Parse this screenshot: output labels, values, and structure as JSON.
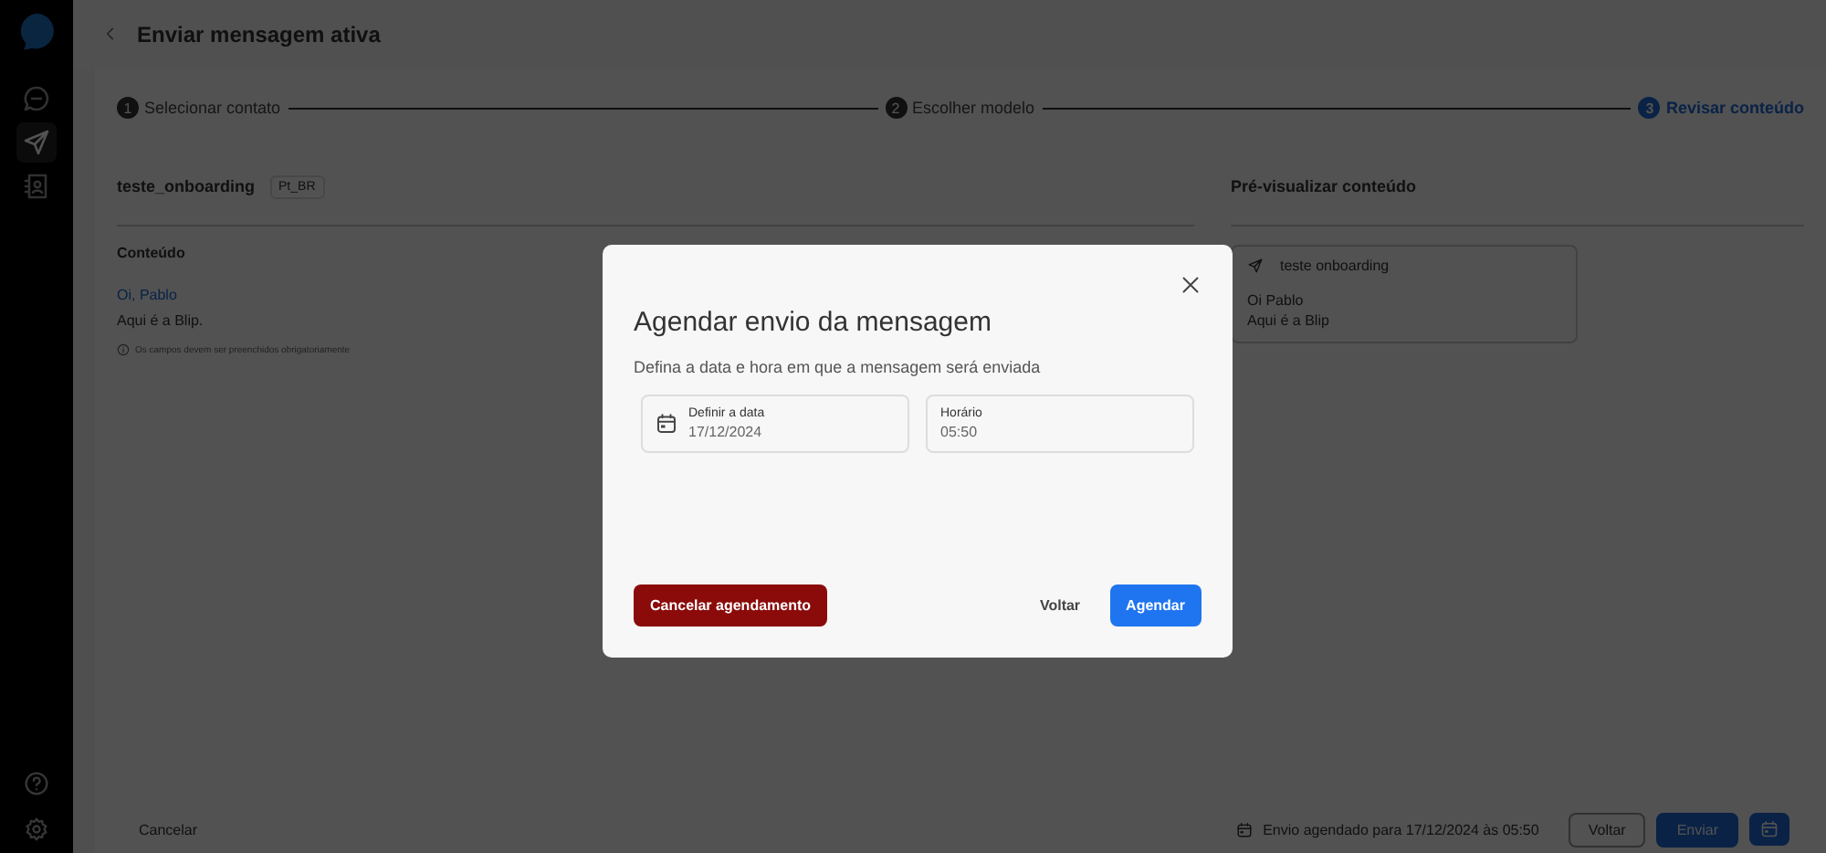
{
  "sidebar": {
    "items": [
      {
        "selected": false
      },
      {
        "selected": true
      },
      {
        "selected": false
      }
    ]
  },
  "header": {
    "title": "Enviar mensagem ativa"
  },
  "steps": [
    {
      "number": "1",
      "label": "Selecionar contato",
      "selected": false
    },
    {
      "number": "2",
      "label": "Escolher modelo",
      "selected": false
    },
    {
      "number": "3",
      "label": "Revisar conteúdo",
      "selected": true
    }
  ],
  "template": {
    "name": "teste_onboarding",
    "language": "Pt_BR"
  },
  "content": {
    "heading": "Conteúdo",
    "greeting": "Oi, Pablo",
    "body": "Aqui é a Blip.",
    "note": "Os campos devem ser preenchidos obrigatoriamente"
  },
  "preview": {
    "heading": "Pré-visualizar conteúdo",
    "title": "teste onboarding",
    "lines": [
      "Oi Pablo",
      "Aqui é a Blip"
    ]
  },
  "footer": {
    "cancel": "Cancelar",
    "status": "Envio agendado para 17/12/2024 às 05:50",
    "buttons": [
      {
        "kind": "secondary",
        "label": "Voltar"
      },
      {
        "kind": "primary",
        "label": "Enviar"
      },
      {
        "kind": "icon"
      }
    ]
  },
  "modal": {
    "title": "Agendar envio da mensagem",
    "subtitle": "Defina a data e hora em que a mensagem será enviada",
    "fields": [
      {
        "kind": "date",
        "label": "Definir a data",
        "value": "17/12/2024"
      },
      {
        "kind": "time",
        "label": "Horário",
        "value": "05:50"
      }
    ],
    "buttons": [
      {
        "kind": "danger",
        "label": "Cancelar agendamento"
      },
      {
        "kind": "text",
        "label": "Voltar"
      },
      {
        "kind": "primary",
        "label": "Agendar"
      }
    ]
  }
}
